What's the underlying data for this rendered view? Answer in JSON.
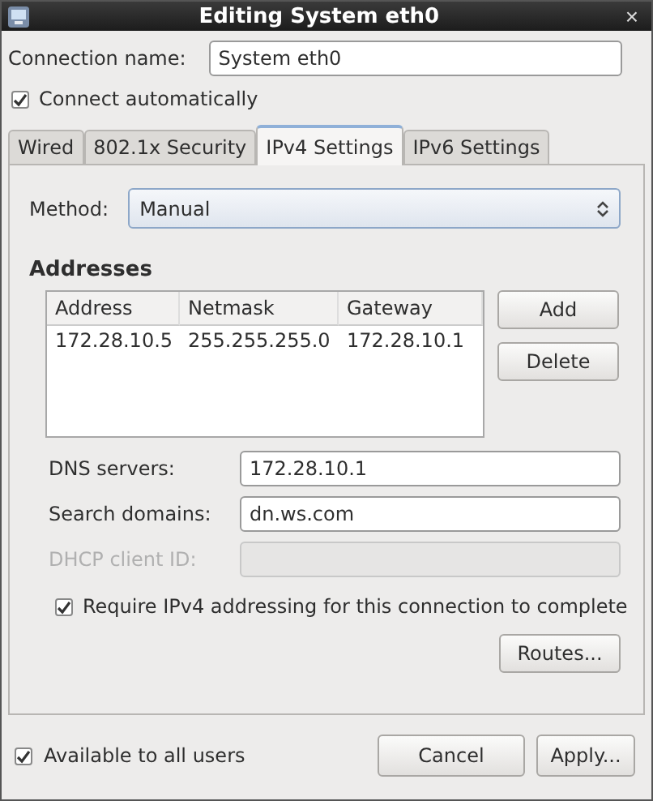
{
  "window": {
    "title": "Editing System eth0",
    "close": "×"
  },
  "connection_name": {
    "label": "Connection name:",
    "value": "System eth0"
  },
  "connect_automatically": {
    "label": "Connect automatically",
    "checked": true
  },
  "tabs": [
    {
      "label": "Wired",
      "selected": false
    },
    {
      "label": "802.1x Security",
      "selected": false
    },
    {
      "label": "IPv4 Settings",
      "selected": true
    },
    {
      "label": "IPv6 Settings",
      "selected": false
    }
  ],
  "method": {
    "label": "Method:",
    "value": "Manual"
  },
  "addresses": {
    "heading": "Addresses",
    "columns": [
      "Address",
      "Netmask",
      "Gateway"
    ],
    "rows": [
      [
        "172.28.10.5",
        "255.255.255.0",
        "172.28.10.1"
      ]
    ],
    "buttons": [
      "Add",
      "Delete"
    ]
  },
  "fields": [
    {
      "label": "DNS servers:",
      "value": "172.28.10.1",
      "disabled": false
    },
    {
      "label": "Search domains:",
      "value": "dn.ws.com",
      "disabled": false
    },
    {
      "label": "DHCP client ID:",
      "disabled": true
    }
  ],
  "require_ipv4": {
    "label": "Require IPv4 addressing for this connection to complete",
    "checked": true
  },
  "routes_button": "Routes...",
  "available_to_all": {
    "label": "Available to all users",
    "checked": true
  },
  "footer_buttons": [
    "Cancel",
    "Apply..."
  ]
}
